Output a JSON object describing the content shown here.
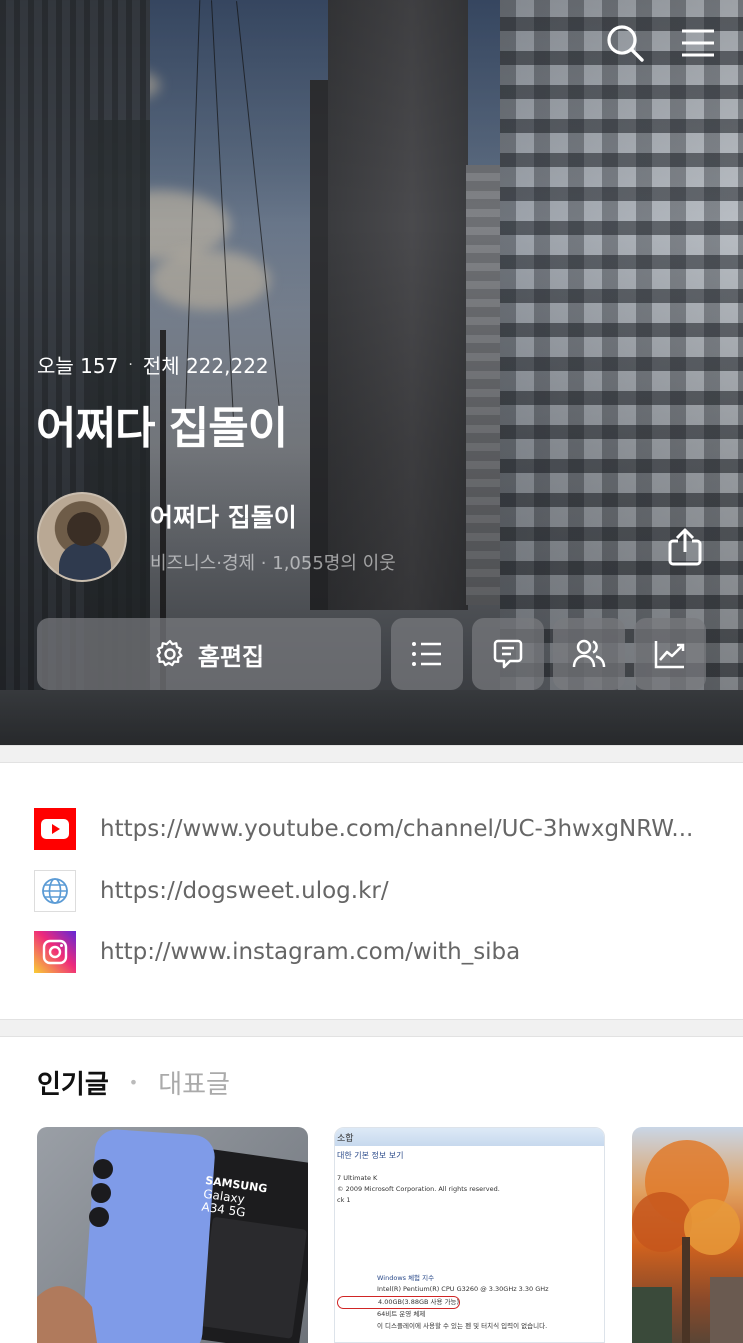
{
  "header": {
    "search_icon": "search-icon",
    "menu_icon": "hamburger-menu-icon"
  },
  "stats": {
    "today_label": "오늘 157",
    "separator": "·",
    "total_label": "전체 222,222"
  },
  "blog": {
    "title": "어쩌다 집돌이",
    "nickname": "어쩌다 집돌이",
    "meta": "비즈니스·경제 · 1,055명의 이웃"
  },
  "actions": {
    "edit_label": "홈편집",
    "buttons": [
      "list-icon",
      "comment-icon",
      "neighbors-icon",
      "stats-icon"
    ]
  },
  "links": [
    {
      "icon": "youtube-icon",
      "url": "https://www.youtube.com/channel/UC-3hwxgNRW..."
    },
    {
      "icon": "globe-icon",
      "url": "https://dogsweet.ulog.kr/"
    },
    {
      "icon": "instagram-icon",
      "url": "http://www.instagram.com/with_siba"
    }
  ],
  "posts": {
    "tab_active": "인기글",
    "separator": "•",
    "tab_inactive": "대표글",
    "thumb1_text": {
      "brand": "SAMSUNG",
      "model1": "Galaxy",
      "model2": "A34 5G"
    },
    "thumb2_text": {
      "header": "소합",
      "line1": "대한 기본 정보 보기",
      "line2": "7 Ultimate K",
      "line3": "© 2009 Microsoft Corporation. All rights reserved.",
      "line4": "ck 1",
      "line5": "Windows 체험 지수",
      "line6": "Intel(R) Pentium(R) CPU G3260 @ 3.30GHz  3.30 GHz",
      "line7": "4.00GB(3.88GB 사용 가능)",
      "line8": "64비트 운영 체제",
      "line9": "이 디스플레이에 사용할 수 있는 펜 및 터치식 입력이 없습니다."
    }
  },
  "colors": {
    "youtube": "#ff0000",
    "instagram_start": "#f9ce34",
    "instagram_mid": "#ee2a7b",
    "instagram_end": "#6228d7",
    "button_bg": "#7a7c7e",
    "divider": "#f1f1f1"
  }
}
